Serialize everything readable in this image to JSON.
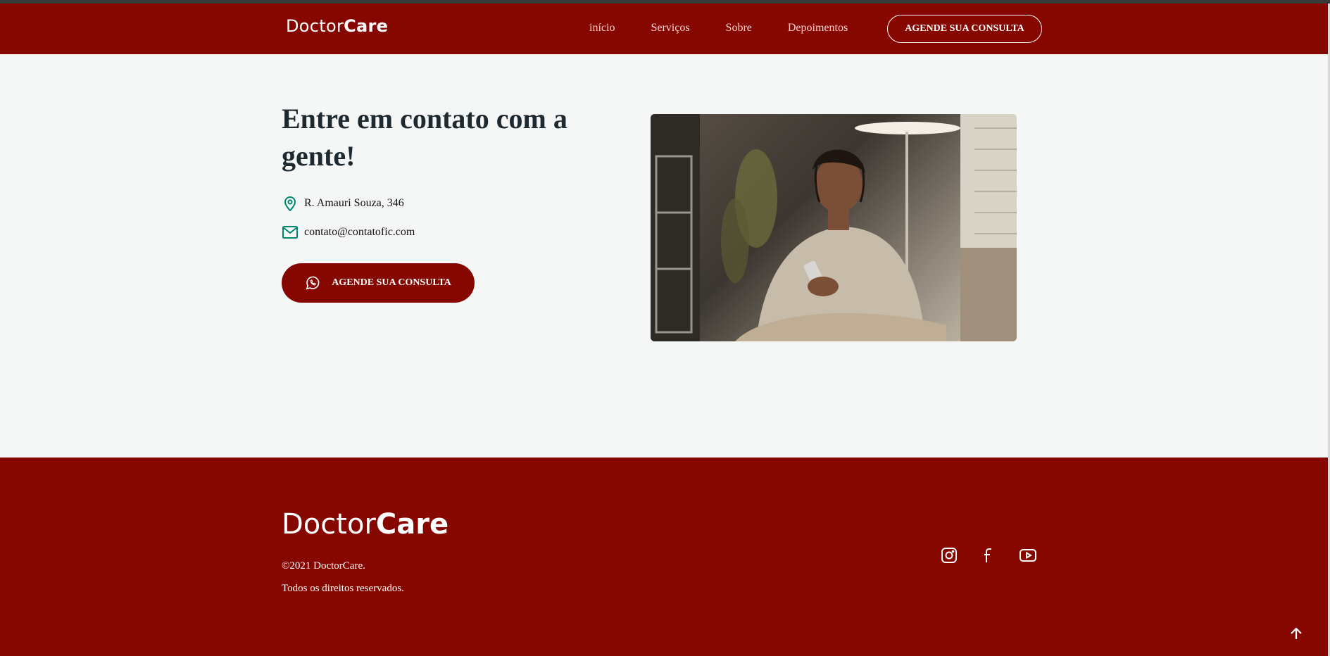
{
  "header": {
    "logo_prefix": "Doctor",
    "logo_suffix": "Care",
    "nav": [
      "início",
      "Serviços",
      "Sobre",
      "Depoimentos"
    ],
    "cta_label": "AGENDE SUA CONSULTA"
  },
  "contact": {
    "title": "Entre em contato com a gente!",
    "address": "R. Amauri Souza, 346",
    "email": "contato@contatofic.com",
    "cta_label": "AGENDE SUA CONSULTA",
    "icons": [
      "map-pin-icon",
      "mail-icon",
      "whatsapp-icon"
    ]
  },
  "footer": {
    "logo_prefix": "Doctor",
    "logo_suffix": "Care",
    "copyright": "©2021 DoctorCare.",
    "rights": "Todos os direitos reservados.",
    "social_icons": [
      "instagram-icon",
      "facebook-icon",
      "youtube-icon"
    ],
    "back_to_top_icon": "arrow-up-icon"
  },
  "colors": {
    "brand": "#860600",
    "background": "#F5F7F7",
    "icon_accent": "#00856F"
  }
}
